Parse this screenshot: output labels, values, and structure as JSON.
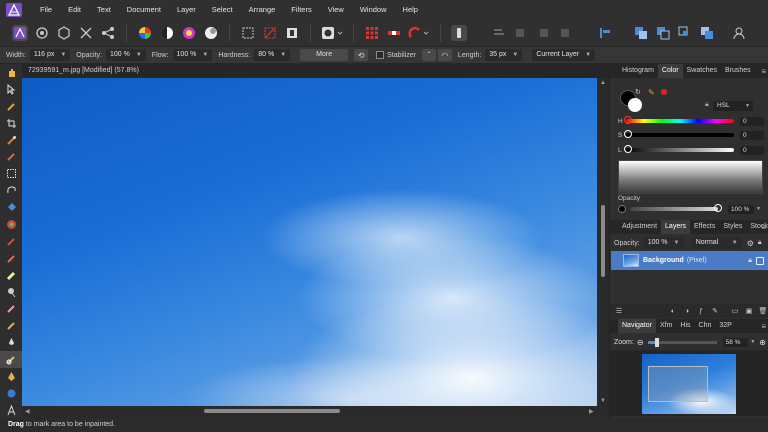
{
  "menu": {
    "items": [
      "File",
      "Edit",
      "Text",
      "Document",
      "Layer",
      "Select",
      "Arrange",
      "Filters",
      "View",
      "Window",
      "Help"
    ]
  },
  "context_toolbar": {
    "width_label": "Width:",
    "width_value": "116 px",
    "opacity_label": "Opacity:",
    "opacity_value": "100 %",
    "flow_label": "Flow:",
    "flow_value": "100 %",
    "hardness_label": "Hardness:",
    "hardness_value": "80 %",
    "more_label": "More",
    "stabilizer_label": "Stabilizer",
    "length_label": "Length:",
    "length_value": "35 px",
    "layer_scope": "Current Layer"
  },
  "document": {
    "tab_title": "72939591_m.jpg [Modified] (57.8%)"
  },
  "color_panel": {
    "tabs": [
      "Histogram",
      "Color",
      "Swatches",
      "Brushes"
    ],
    "active_tab": "Color",
    "model": "HSL",
    "h_label": "H",
    "h_value": "0",
    "s_label": "S",
    "s_value": "0",
    "l_label": "L",
    "l_value": "0",
    "opacity_label": "Opacity",
    "opacity_value": "100 %",
    "accent": "#e02020"
  },
  "layers_panel": {
    "tabs": [
      "Adjustment",
      "Layers",
      "Effects",
      "Styles",
      "Stock"
    ],
    "active_tab": "Layers",
    "opacity_label": "Opacity:",
    "opacity_value": "100 %",
    "blend_mode": "Normal",
    "layer_name": "Background",
    "layer_kind": "(Pixel)",
    "selected_color": "#4b7bc4"
  },
  "navigator_panel": {
    "tabs": [
      "Navigator",
      "Xfm",
      "His",
      "Chn",
      "32P"
    ],
    "active_tab": "Navigator",
    "zoom_label": "Zoom:",
    "zoom_value": "58 %",
    "zoom_level": 0.14
  },
  "status": {
    "action": "Drag",
    "message": "to mark area to be inpainted."
  }
}
